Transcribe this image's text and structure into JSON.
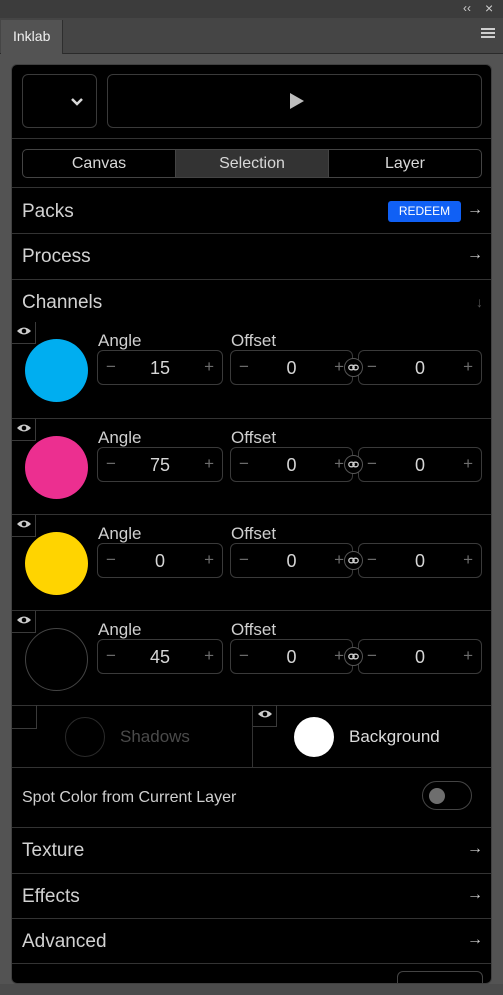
{
  "window": {
    "collapse_glyph": "‹‹",
    "close_glyph": "×"
  },
  "tab": {
    "title": "Inklab"
  },
  "icons": {
    "menu": "hamburger-icon",
    "dropdown": "chevron-down-icon",
    "play": "play-icon",
    "arrow": "arrow-right-icon",
    "collapse": "arrow-down-icon",
    "eye": "eye-icon",
    "link": "link-icon"
  },
  "top_controls": {
    "dropdown_glyph": "⌄",
    "play_glyph": "▶"
  },
  "mode_tabs": [
    {
      "label": "Canvas",
      "active": false
    },
    {
      "label": "Selection",
      "active": true
    },
    {
      "label": "Layer",
      "active": false
    }
  ],
  "packs": {
    "label": "Packs",
    "redeem_label": "REDEEM",
    "arrow": "→"
  },
  "process": {
    "label": "Process",
    "arrow": "→"
  },
  "channels": {
    "label": "Channels",
    "collapse_arrow": "↓",
    "angle_label": "Angle",
    "offset_label": "Offset",
    "minus": "−",
    "plus": "+",
    "items": [
      {
        "color": "#00aef0",
        "angle": "15",
        "offset_x": "0",
        "offset_y": "0"
      },
      {
        "color": "#ec2f90",
        "angle": "75",
        "offset_x": "0",
        "offset_y": "0"
      },
      {
        "color": "#ffd400",
        "angle": "0",
        "offset_x": "0",
        "offset_y": "0"
      },
      {
        "color": "#000000",
        "angle": "45",
        "offset_x": "0",
        "offset_y": "0"
      }
    ]
  },
  "shadows": {
    "label": "Shadows"
  },
  "background": {
    "label": "Background",
    "color": "#ffffff"
  },
  "spot_color": {
    "label": "Spot Color from Current Layer",
    "enabled": false
  },
  "texture": {
    "label": "Texture",
    "arrow": "→"
  },
  "effects": {
    "label": "Effects",
    "arrow": "→"
  },
  "advanced": {
    "label": "Advanced",
    "arrow": "→"
  }
}
